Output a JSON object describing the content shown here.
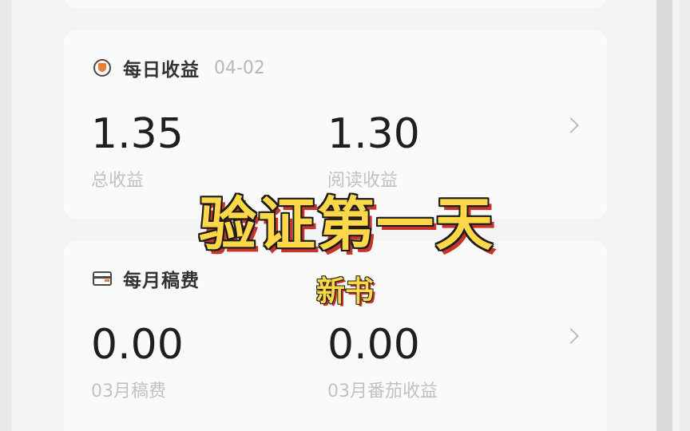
{
  "daily": {
    "title": "每日收益",
    "date": "04-02",
    "total_value": "1.35",
    "total_label": "总收益",
    "read_value": "1.30",
    "read_label": "阅读收益"
  },
  "monthly": {
    "title": "每月稿费",
    "fee_value": "0.00",
    "fee_label": "03月稿费",
    "fanqie_value": "0.00",
    "fanqie_label": "03月番茄收益"
  },
  "overlay": {
    "title": "验证第一天",
    "subtitle": "新书"
  },
  "colors": {
    "accent": "#f07a3c",
    "overlay_text": "#ffd84a",
    "overlay_shadow": "#c6342a"
  },
  "icons": {
    "daily": "medal-icon",
    "monthly": "wallet-card-icon",
    "arrow": "chevron-right-icon"
  }
}
